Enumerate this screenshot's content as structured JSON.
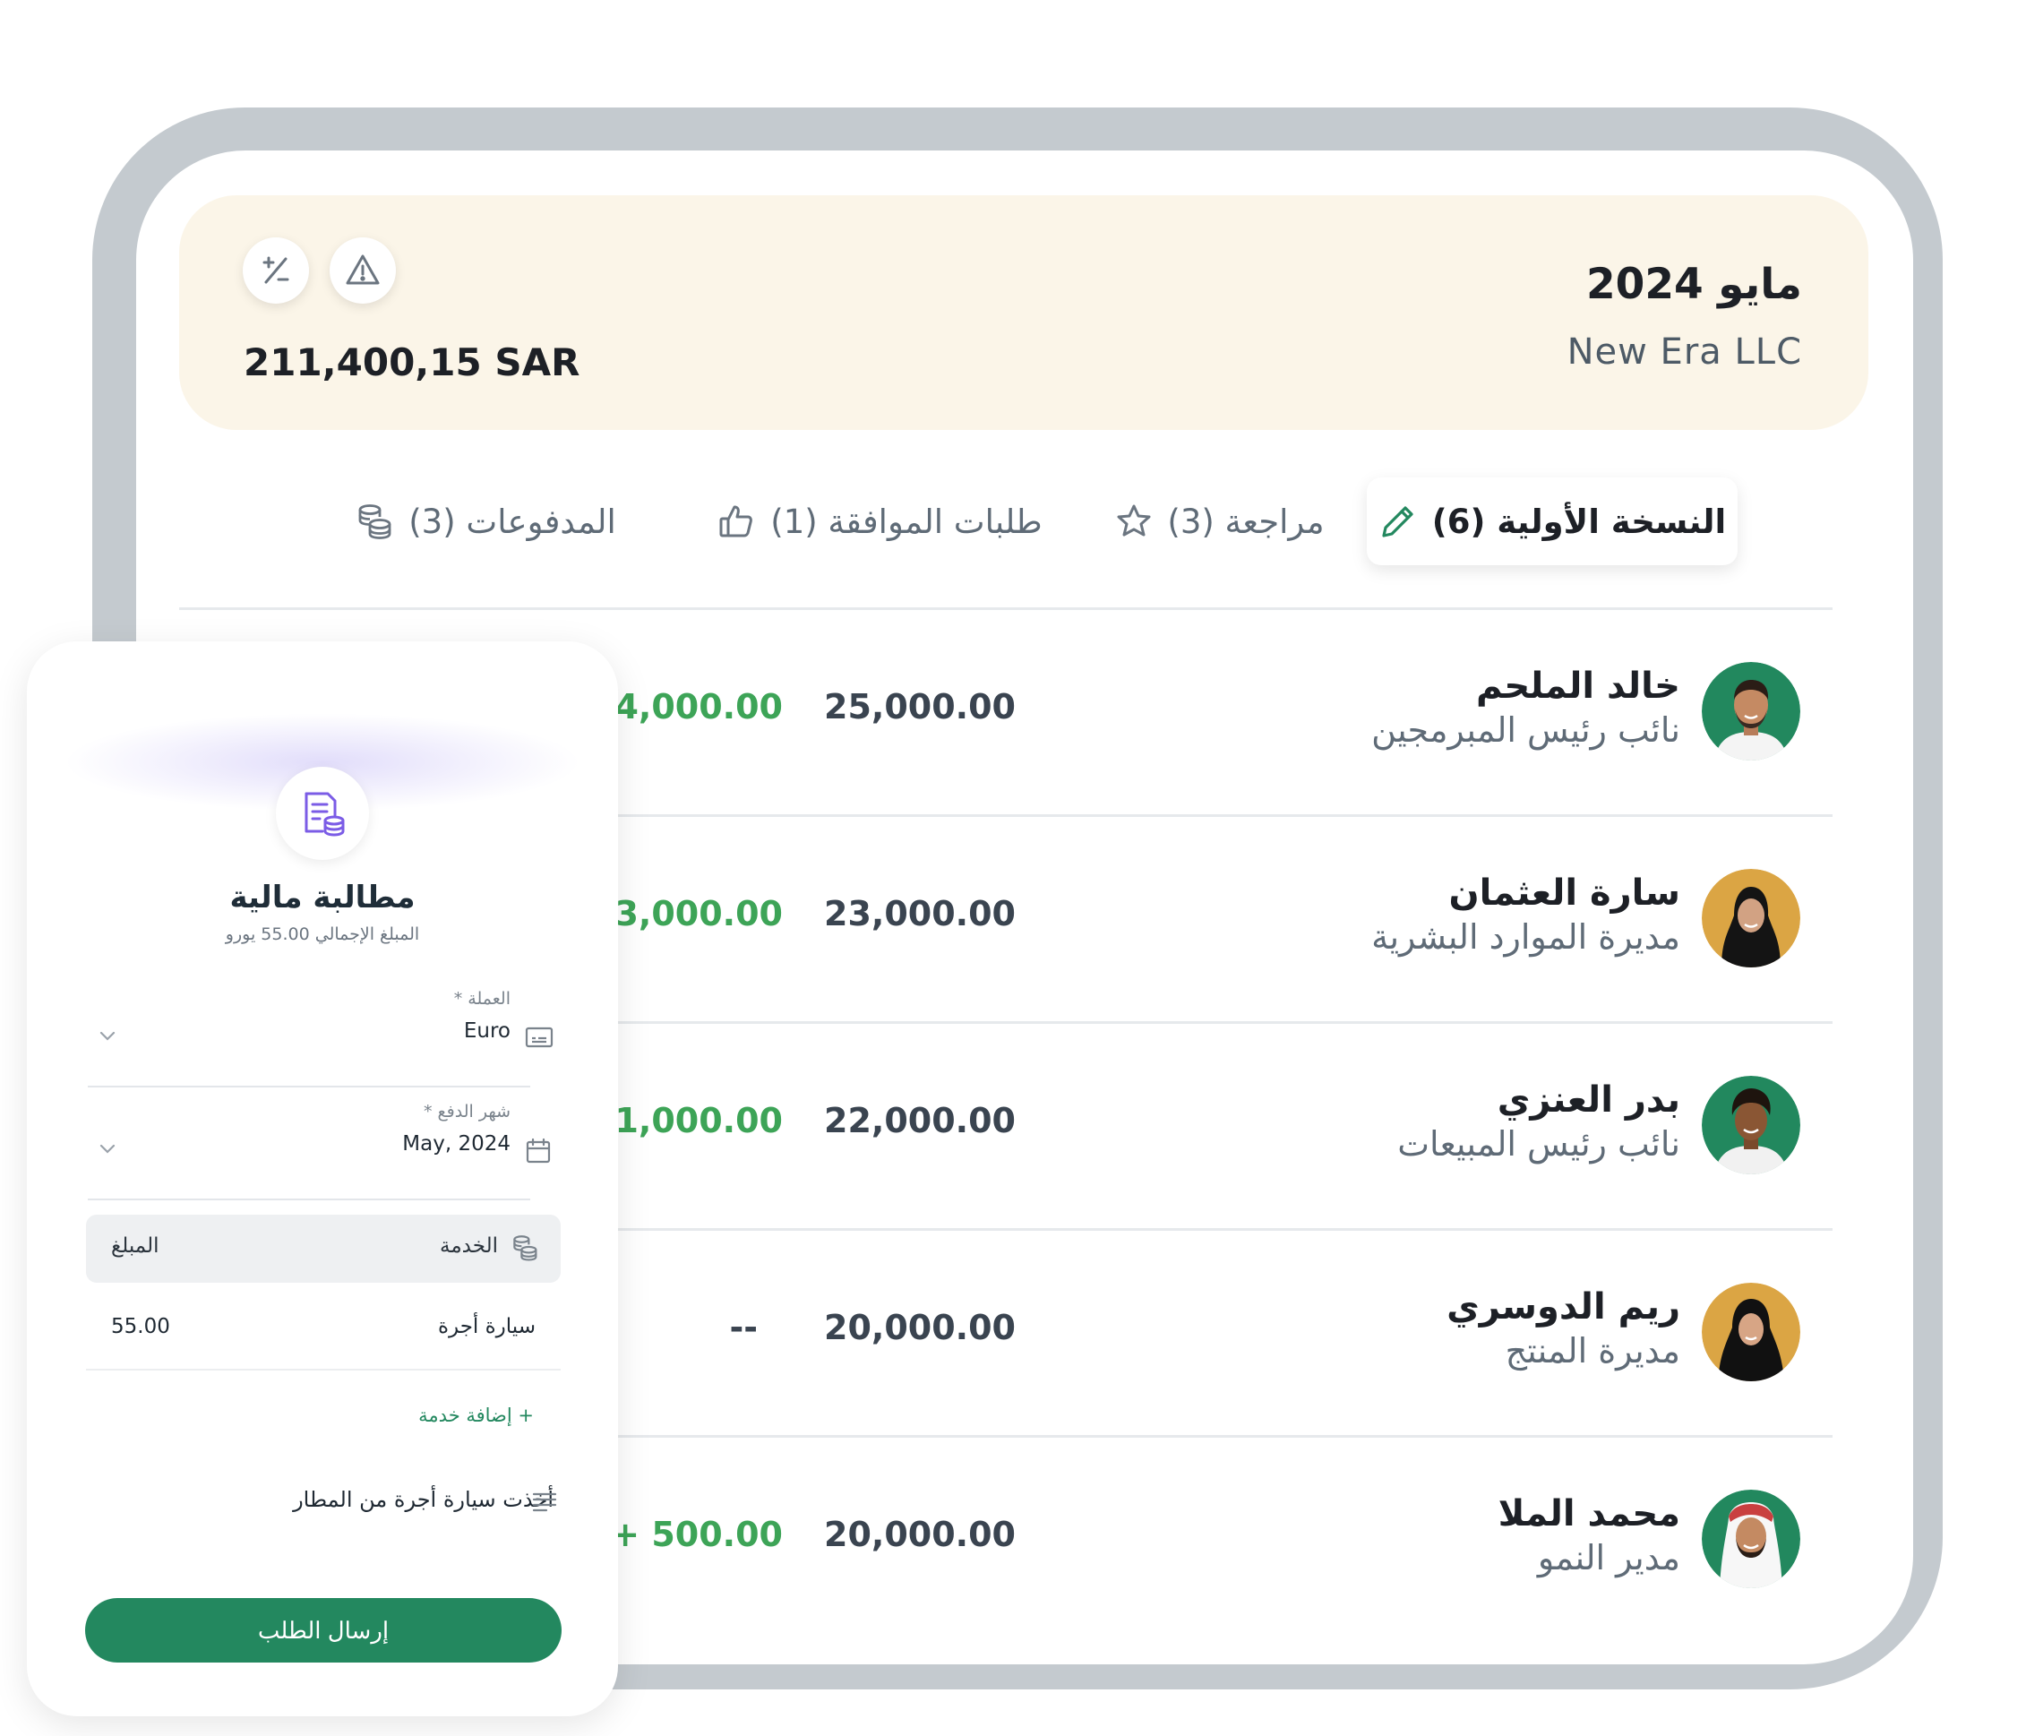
{
  "summary": {
    "month": "مايو 2024",
    "company": "New Era LLC",
    "total": "211,400,15 SAR",
    "icons": [
      "plus-minus-icon",
      "warning-icon"
    ]
  },
  "tabs": [
    {
      "label": "النسخة الأولية (6)",
      "icon": "pencil-icon",
      "active": true
    },
    {
      "label": "مراجعة (3)",
      "icon": "star-icon",
      "active": false
    },
    {
      "label": "طلبات الموافقة (1)",
      "icon": "thumbs-up-icon",
      "active": false
    },
    {
      "label": "المدفوعات (3)",
      "icon": "coins-icon",
      "active": false
    }
  ],
  "employees": [
    {
      "name": "خالد الملحم",
      "role": "نائب رئيس المبرمجين",
      "salary": "25,000.00",
      "extra": "4,000.00",
      "avatar_color": "#22885e"
    },
    {
      "name": "سارة العثمان",
      "role": "مديرة الموارد البشرية",
      "salary": "23,000.00",
      "extra": "3,000.00",
      "avatar_color": "#dba544"
    },
    {
      "name": "بدر العنزي",
      "role": "نائب رئيس المبيعات",
      "salary": "22,000.00",
      "extra": "1,000.00",
      "avatar_color": "#22885e"
    },
    {
      "name": "ريم الدوسري",
      "role": "مديرة المنتج",
      "salary": "20,000.00",
      "extra": "--",
      "avatar_color": "#dba544"
    },
    {
      "name": "محمد الملا",
      "role": "مدير النمو",
      "salary": "20,000.00",
      "extra": "+ 500.00",
      "avatar_color": "#22885e"
    }
  ],
  "claim": {
    "title": "مطالبة مالية",
    "subtitle": "المبلغ الإجمالي 55.00 يورو",
    "currency": {
      "label": "العملة *",
      "value": "Euro"
    },
    "month": {
      "label": "شهر الدفع *",
      "value": "May, 2024"
    },
    "table": {
      "service_header": "الخدمة",
      "amount_header": "المبلغ",
      "rows": [
        {
          "service": "سيارة أجرة",
          "amount": "55.00"
        }
      ]
    },
    "add_service": "+ إضافة خدمة",
    "note": "أخذت سيارة أجرة من المطار",
    "submit": "إرسال الطلب"
  },
  "colors": {
    "accent_green": "#23885f",
    "positive_green": "#3da457",
    "summary_bg": "#fbf5e8",
    "frame_gray": "#c4cacf"
  }
}
